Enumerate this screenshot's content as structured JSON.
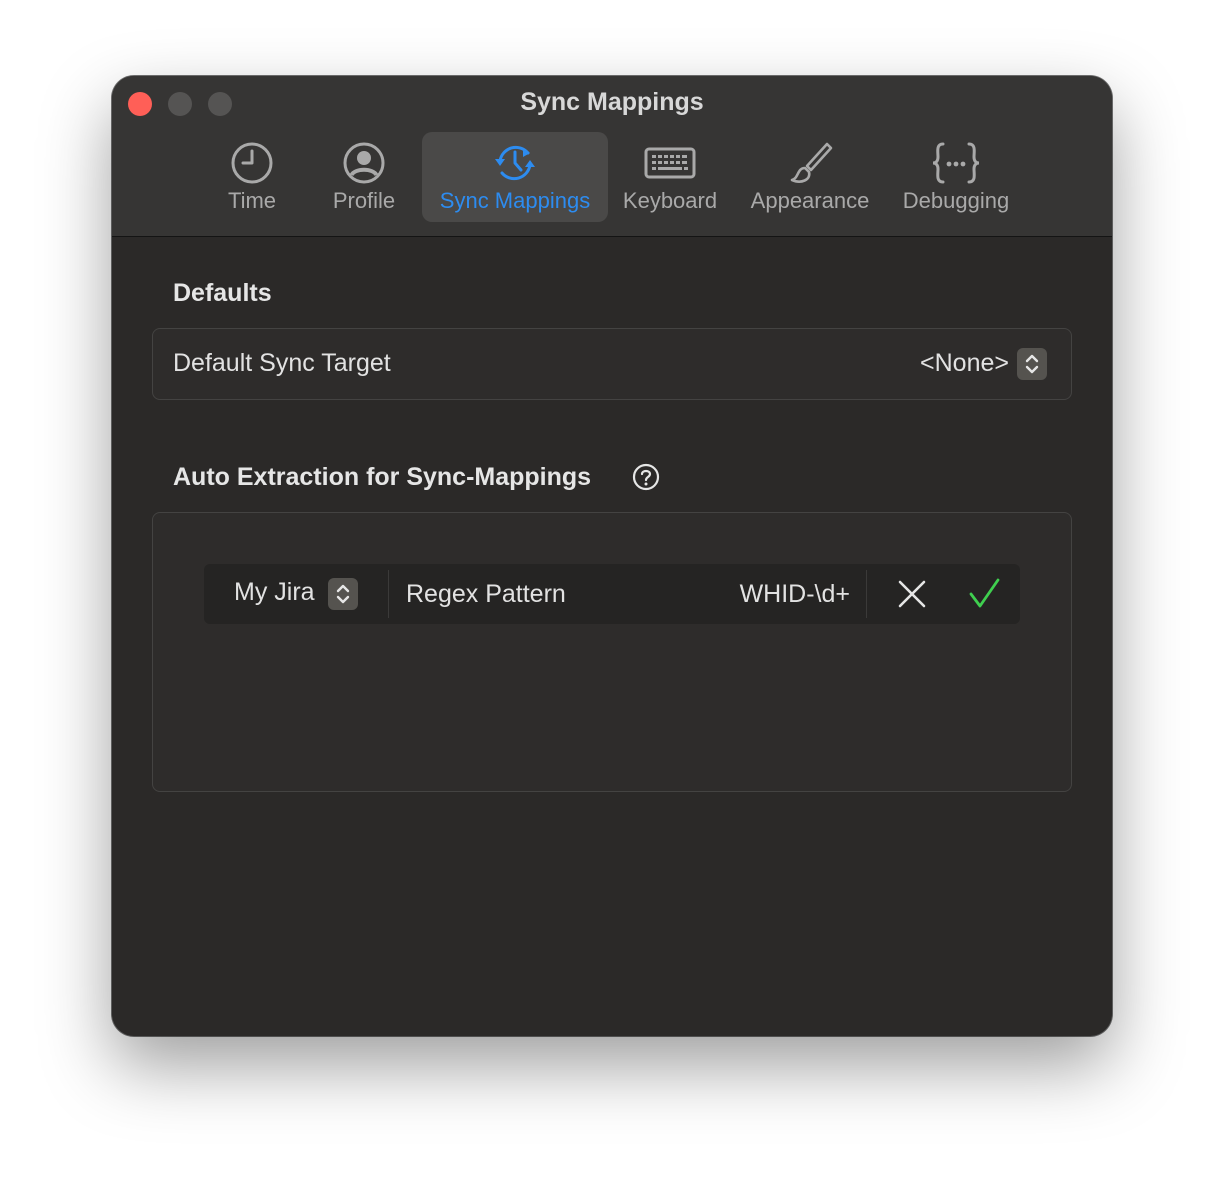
{
  "window": {
    "title": "Sync Mappings"
  },
  "toolbar": {
    "tabs": [
      {
        "label": "Time",
        "icon": "clock-icon"
      },
      {
        "label": "Profile",
        "icon": "person-circle-icon"
      },
      {
        "label": "Sync Mappings",
        "icon": "sync-clock-icon",
        "active": true
      },
      {
        "label": "Keyboard",
        "icon": "keyboard-icon"
      },
      {
        "label": "Appearance",
        "icon": "paintbrush-icon"
      },
      {
        "label": "Debugging",
        "icon": "curly-braces-icon"
      }
    ]
  },
  "defaults": {
    "heading": "Defaults",
    "sync_target_label": "Default Sync Target",
    "sync_target_value": "<None>"
  },
  "auto_extraction": {
    "heading": "Auto Extraction for Sync-Mappings",
    "rules": [
      {
        "target": "My Jira",
        "type": "Regex Pattern",
        "pattern": "WHID-\\d+"
      }
    ]
  },
  "colors": {
    "accent": "#2d8cf0",
    "confirm": "#3fcf4f",
    "close_button": "#ff5f57",
    "window_bg": "#2b2928",
    "titlebar_bg": "#363534"
  }
}
